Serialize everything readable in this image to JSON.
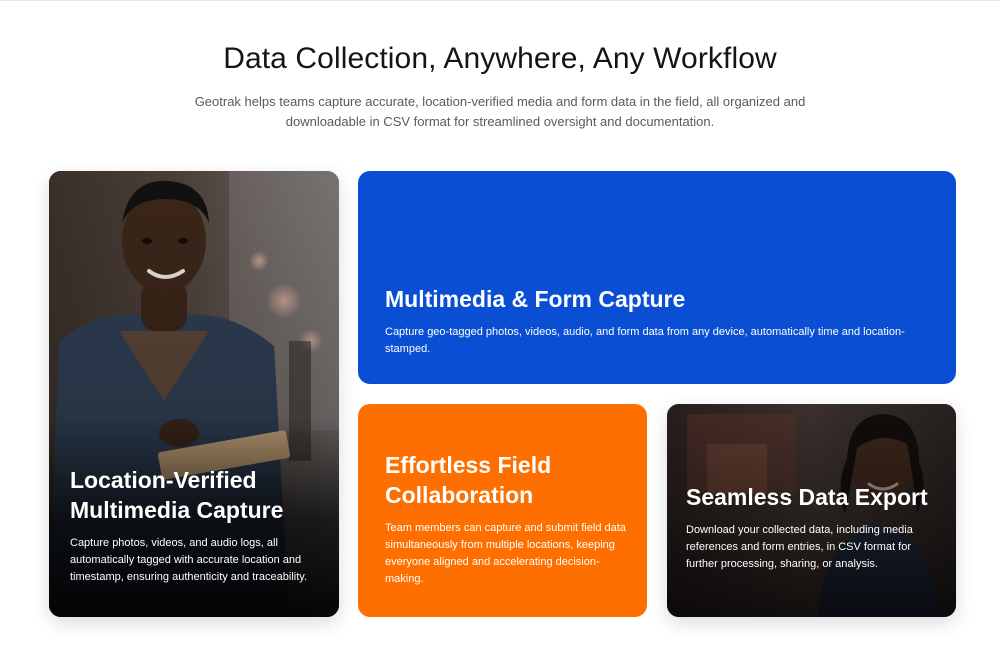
{
  "header": {
    "title": "Data Collection, Anywhere, Any Workflow",
    "subtitle": "Geotrak helps teams capture accurate, location-verified media and form data in the field, all organized and downloadable in CSV format for streamlined oversight and documentation."
  },
  "cards": {
    "location": {
      "title": "Location-Verified Multimedia Capture",
      "text": "Capture photos, videos, and audio logs, all automatically tagged with accurate location and timestamp, ensuring authenticity and traceability."
    },
    "multimedia": {
      "title": "Multimedia & Form Capture",
      "text": "Capture geo-tagged photos, videos, audio, and form data from any device, automatically time and location-stamped."
    },
    "collaboration": {
      "title": "Effortless Field Collaboration",
      "text": "Team members can capture and submit field data simultaneously from multiple locations, keeping everyone aligned and accelerating decision-making."
    },
    "export": {
      "title": "Seamless Data Export",
      "text": "Download your collected data, including media references and form entries, in CSV format for further processing, sharing, or analysis."
    }
  },
  "colors": {
    "blue_card": "#0a4fd3",
    "orange_card": "#ff6f00",
    "heading": "#141414",
    "subtext": "#555b63"
  }
}
